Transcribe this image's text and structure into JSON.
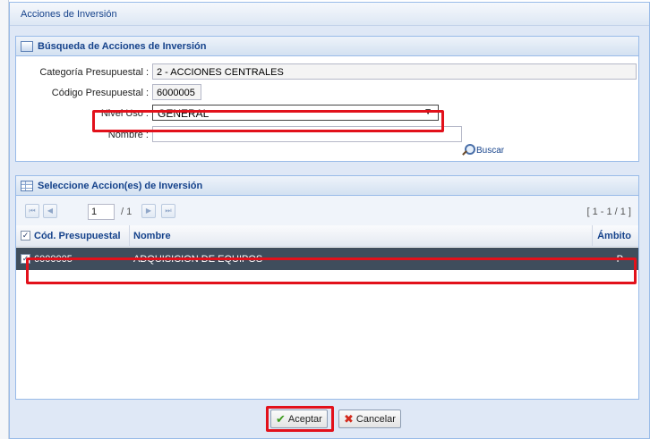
{
  "window": {
    "title": "Acciones de Inversión"
  },
  "search_panel": {
    "title": "Búsqueda de Acciones de Inversión",
    "categoria_label": "Categoría Presupuestal :",
    "categoria_value": "2 - ACCIONES CENTRALES",
    "codigo_label": "Código Presupuestal :",
    "codigo_value": "6000005",
    "nivel_label": "Nivel Uso :",
    "nivel_value": "GENERAL",
    "nombre_label": "Nombre :",
    "nombre_value": "",
    "buscar_label": "Buscar",
    "select_arrow": "▼"
  },
  "select_panel": {
    "title": "Seleccione Accion(es) de Inversión",
    "pager": {
      "first": "⏮",
      "prev": "◀",
      "page": "1",
      "total": "/ 1",
      "next": "▶",
      "last": "⏭",
      "range": "[ 1 - 1 / 1 ]"
    },
    "columns": [
      "Cód. Presupuestal",
      "Nombre",
      "Ámbito"
    ],
    "rows": [
      {
        "codigo": "6000005",
        "nombre": "ADQUISICION DE EQUIPOS",
        "ambito": "P",
        "checked": true
      }
    ],
    "header_checked": true,
    "check_mark": "✓"
  },
  "footer": {
    "aceptar_label": "Aceptar",
    "cancelar_label": "Cancelar",
    "aceptar_icon": "✔",
    "cancelar_icon": "✖"
  },
  "colors": {
    "highlight_border": "#e2111b",
    "selected_row": "#3f4d5c",
    "panel_title": "#15428b"
  }
}
